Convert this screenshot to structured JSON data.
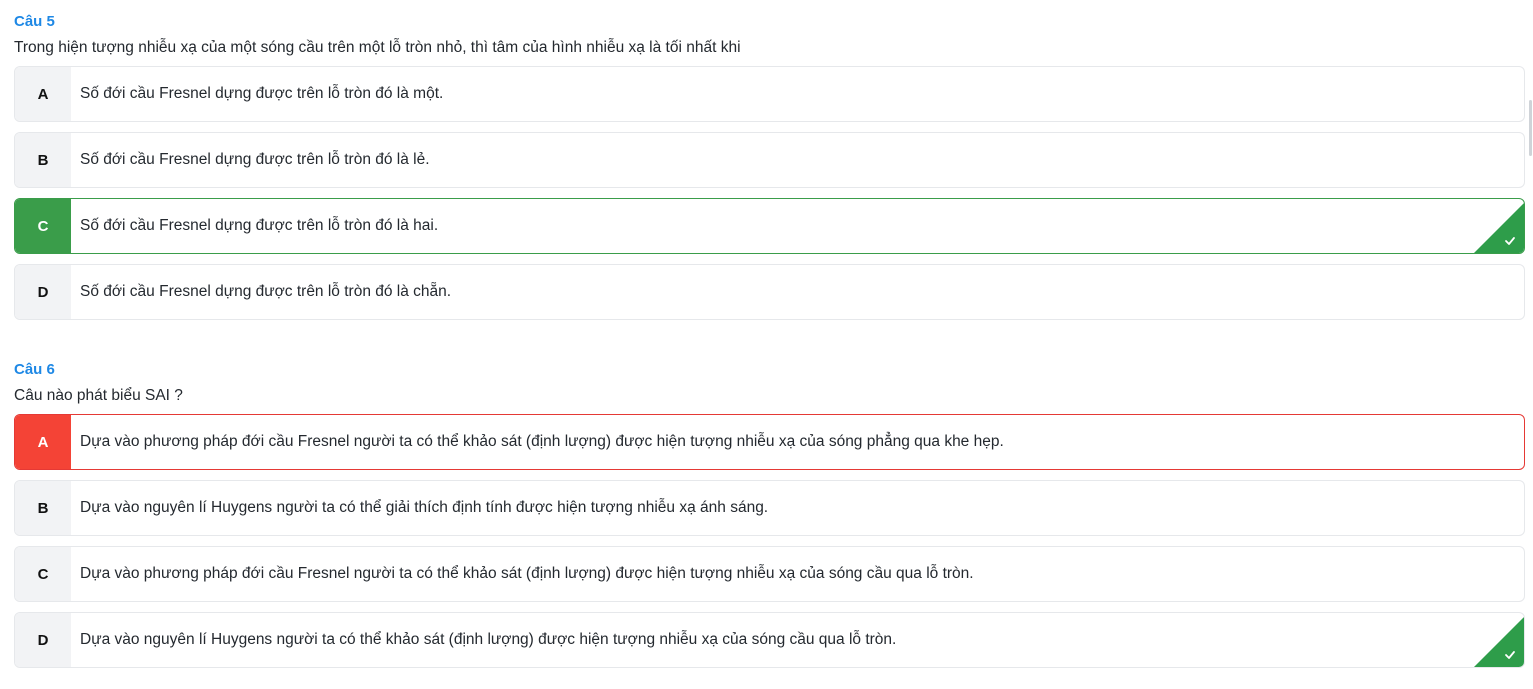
{
  "questions": [
    {
      "title": "Câu 5",
      "text": "Trong hiện tượng nhiễu xạ của một sóng cầu trên một lỗ tròn nhỏ, thì tâm của hình nhiễu xạ là tối nhất khi",
      "options": [
        {
          "letter": "A",
          "text": "Số đới cầu Fresnel dựng được trên lỗ tròn đó là một.",
          "state": "none"
        },
        {
          "letter": "B",
          "text": "Số đới cầu Fresnel dựng được trên lỗ tròn đó là lẻ.",
          "state": "none"
        },
        {
          "letter": "C",
          "text": "Số đới cầu Fresnel dựng được trên lỗ tròn đó là hai.",
          "state": "correct-selected",
          "correct_marker": "check-icon"
        },
        {
          "letter": "D",
          "text": "Số đới cầu Fresnel dựng được trên lỗ tròn đó là chẵn.",
          "state": "none"
        }
      ]
    },
    {
      "title": "Câu 6",
      "text": "Câu nào phát biểu SAI ?",
      "options": [
        {
          "letter": "A",
          "text": "Dựa vào phương pháp đới cầu Fresnel người ta có thể khảo sát (định lượng) được hiện tượng nhiễu xạ của sóng phẳng qua khe hẹp.",
          "state": "wrong-selected"
        },
        {
          "letter": "B",
          "text": "Dựa vào nguyên lí Huygens người ta có thể giải thích định tính được hiện tượng nhiễu xạ ánh sáng.",
          "state": "none"
        },
        {
          "letter": "C",
          "text": "Dựa vào phương pháp đới cầu Fresnel người ta có thể khảo sát (định lượng) được hiện tượng nhiễu xạ của sóng cầu qua lỗ tròn.",
          "state": "none"
        },
        {
          "letter": "D",
          "text": "Dựa vào nguyên lí Huygens người ta có thể khảo sát (định lượng) được hiện tượng nhiễu xạ của sóng cầu qua lỗ tròn.",
          "state": "correct-answer",
          "correct_marker": "check-icon"
        }
      ]
    }
  ],
  "colors": {
    "title": "#1e88e5",
    "correct": "#3a9d4a",
    "correct_corner": "#2e9d4a",
    "wrong": "#f44336"
  }
}
